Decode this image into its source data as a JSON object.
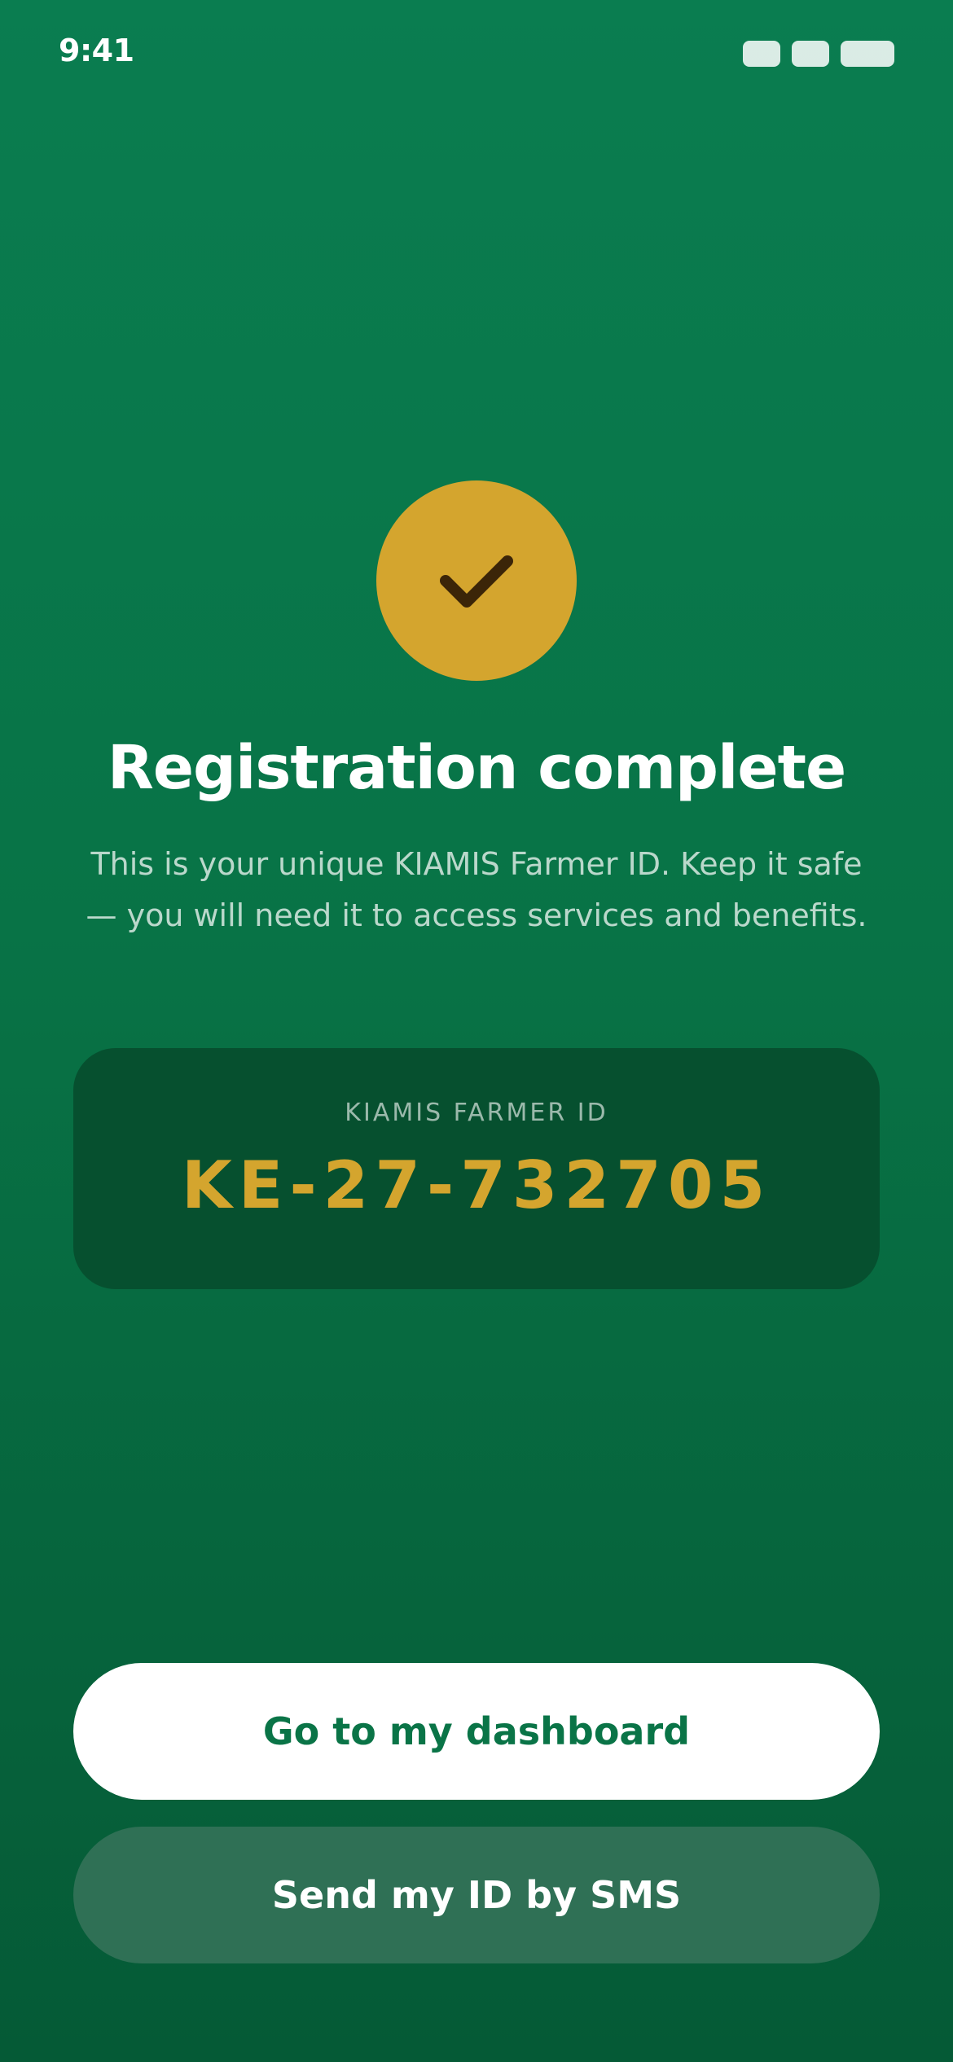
{
  "status_bar": {
    "time": "9:41"
  },
  "success": {
    "icon": "checkmark-icon",
    "badge_color": "#d4a52e",
    "title": "Registration complete",
    "message": "This is your unique KIAMIS Farmer ID. Keep it safe — you will need it to access services and benefits."
  },
  "farmer_id": {
    "label": "KIAMIS FARMER ID",
    "value": "KE-27-732705"
  },
  "actions": {
    "primary_label": "Go to my dashboard",
    "secondary_label": "Send my ID by SMS"
  },
  "colors": {
    "brand_green": "#0a7d50",
    "accent_gold": "#d4a52e",
    "card_bg": "#06502f"
  }
}
